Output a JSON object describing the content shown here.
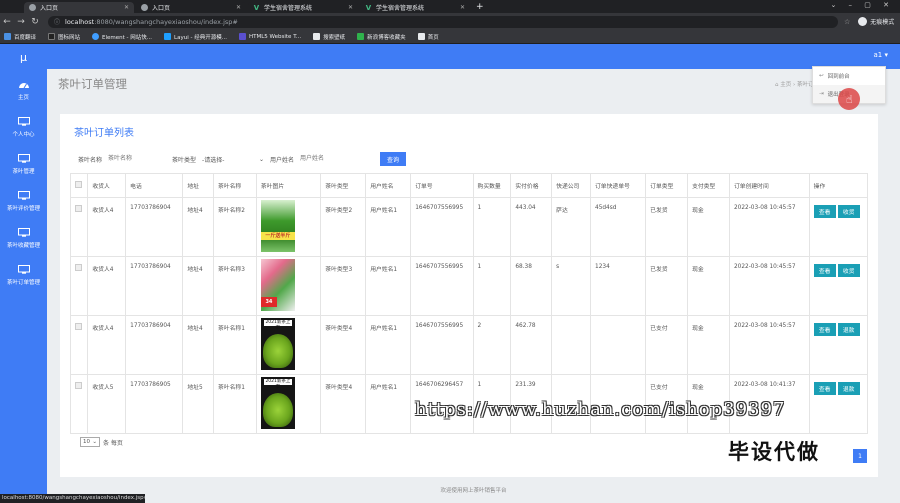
{
  "browser": {
    "tabs": [
      {
        "title": "入口页",
        "active": true
      },
      {
        "title": "入口页",
        "active": false
      },
      {
        "title": "学生宿舍管理系统",
        "active": false
      },
      {
        "title": "学生宿舍管理系统",
        "active": false
      }
    ],
    "url_host": "localhost",
    "url_path": ":8080/wangshangchayexiaoshou/index.jsp#",
    "incognito_label": "无痕模式",
    "bookmarks": [
      "百度翻译",
      "图标网站",
      "Element - 网站快...",
      "Layui - 经典开源模...",
      "HTML5 Website T...",
      "搜索壁纸",
      "新浪博客收藏夹",
      "首页"
    ],
    "status_url": "localhost:8080/wangshangchayexiaoshou/index.jsp#"
  },
  "app": {
    "logo": "μ",
    "user": "a1",
    "sidebar": [
      "主页",
      "个人中心",
      "茶叶管理",
      "茶叶评价管理",
      "茶叶收藏管理",
      "茶叶订单管理"
    ],
    "dropdown": [
      "回到前台",
      "退出登录"
    ],
    "page_title": "茶叶订单管理",
    "breadcrumb": [
      "主页",
      "茶叶订单管理"
    ],
    "card_title": "茶叶订单列表",
    "filters": {
      "name_label": "茶叶名称",
      "name_placeholder": "茶叶名称",
      "type_label": "茶叶类型",
      "type_value": "-请选择-",
      "user_label": "用户姓名",
      "user_placeholder": "用户姓名",
      "search_button": "查询"
    },
    "table": {
      "headers": [
        "",
        "收货人",
        "电话",
        "地址",
        "茶叶名称",
        "茶叶图片",
        "茶叶类型",
        "用户姓名",
        "订单号",
        "购买数量",
        "实付价格",
        "快递公司",
        "订单快递单号",
        "订单类型",
        "支付类型",
        "订单创建时间",
        "操作"
      ],
      "rows": [
        {
          "receiver": "收货人4",
          "phone": "17703786904",
          "address": "地址4",
          "tea_name": "茶叶名称2",
          "tea_type": "茶叶类型2",
          "user": "用户姓名1",
          "order_no": "1646707556995",
          "qty": "1",
          "price": "443.04",
          "express": "萨达",
          "tracking": "45d4sd",
          "order_type": "已发货",
          "pay_type": "现金",
          "created": "2022-03-08 10:45:57",
          "btn1": "查看",
          "btn2": "收货",
          "image_text": "一斤送半斤"
        },
        {
          "receiver": "收货人4",
          "phone": "17703786904",
          "address": "地址4",
          "tea_name": "茶叶名称3",
          "tea_type": "茶叶类型3",
          "user": "用户姓名1",
          "order_no": "1646707556995",
          "qty": "1",
          "price": "68.38",
          "express": "s",
          "tracking": "1234",
          "order_type": "已发货",
          "pay_type": "现金",
          "created": "2022-03-08 10:45:57",
          "btn1": "查看",
          "btn2": "收货",
          "image_text": "34"
        },
        {
          "receiver": "收货人4",
          "phone": "17703786904",
          "address": "地址4",
          "tea_name": "茶叶名称1",
          "tea_type": "茶叶类型4",
          "user": "用户姓名1",
          "order_no": "1646707556995",
          "qty": "2",
          "price": "462.78",
          "express": "",
          "tracking": "",
          "order_type": "已支付",
          "pay_type": "现金",
          "created": "2022-03-08 10:45:57",
          "btn1": "查看",
          "btn2": "退款",
          "image_text": "2021新茶上市"
        },
        {
          "receiver": "收货人5",
          "phone": "17703786905",
          "address": "地址5",
          "tea_name": "茶叶名称1",
          "tea_type": "茶叶类型4",
          "user": "用户姓名1",
          "order_no": "1646706296457",
          "qty": "1",
          "price": "231.39",
          "express": "",
          "tracking": "",
          "order_type": "已支付",
          "pay_type": "现金",
          "created": "2022-03-08 10:41:37",
          "btn1": "查看",
          "btn2": "退款",
          "image_text": "2021新茶上市"
        }
      ]
    },
    "pager": {
      "page_size": "10",
      "suffix": "条 每页",
      "current": "1"
    },
    "footer": "欢迎使用网上茶叶销售平台"
  },
  "watermark": {
    "url": "https://www.huzhan.com/ishop39397",
    "text": "毕设代做"
  },
  "colors": {
    "primary": "#3f7cf5",
    "action": "#1a9fb5"
  }
}
